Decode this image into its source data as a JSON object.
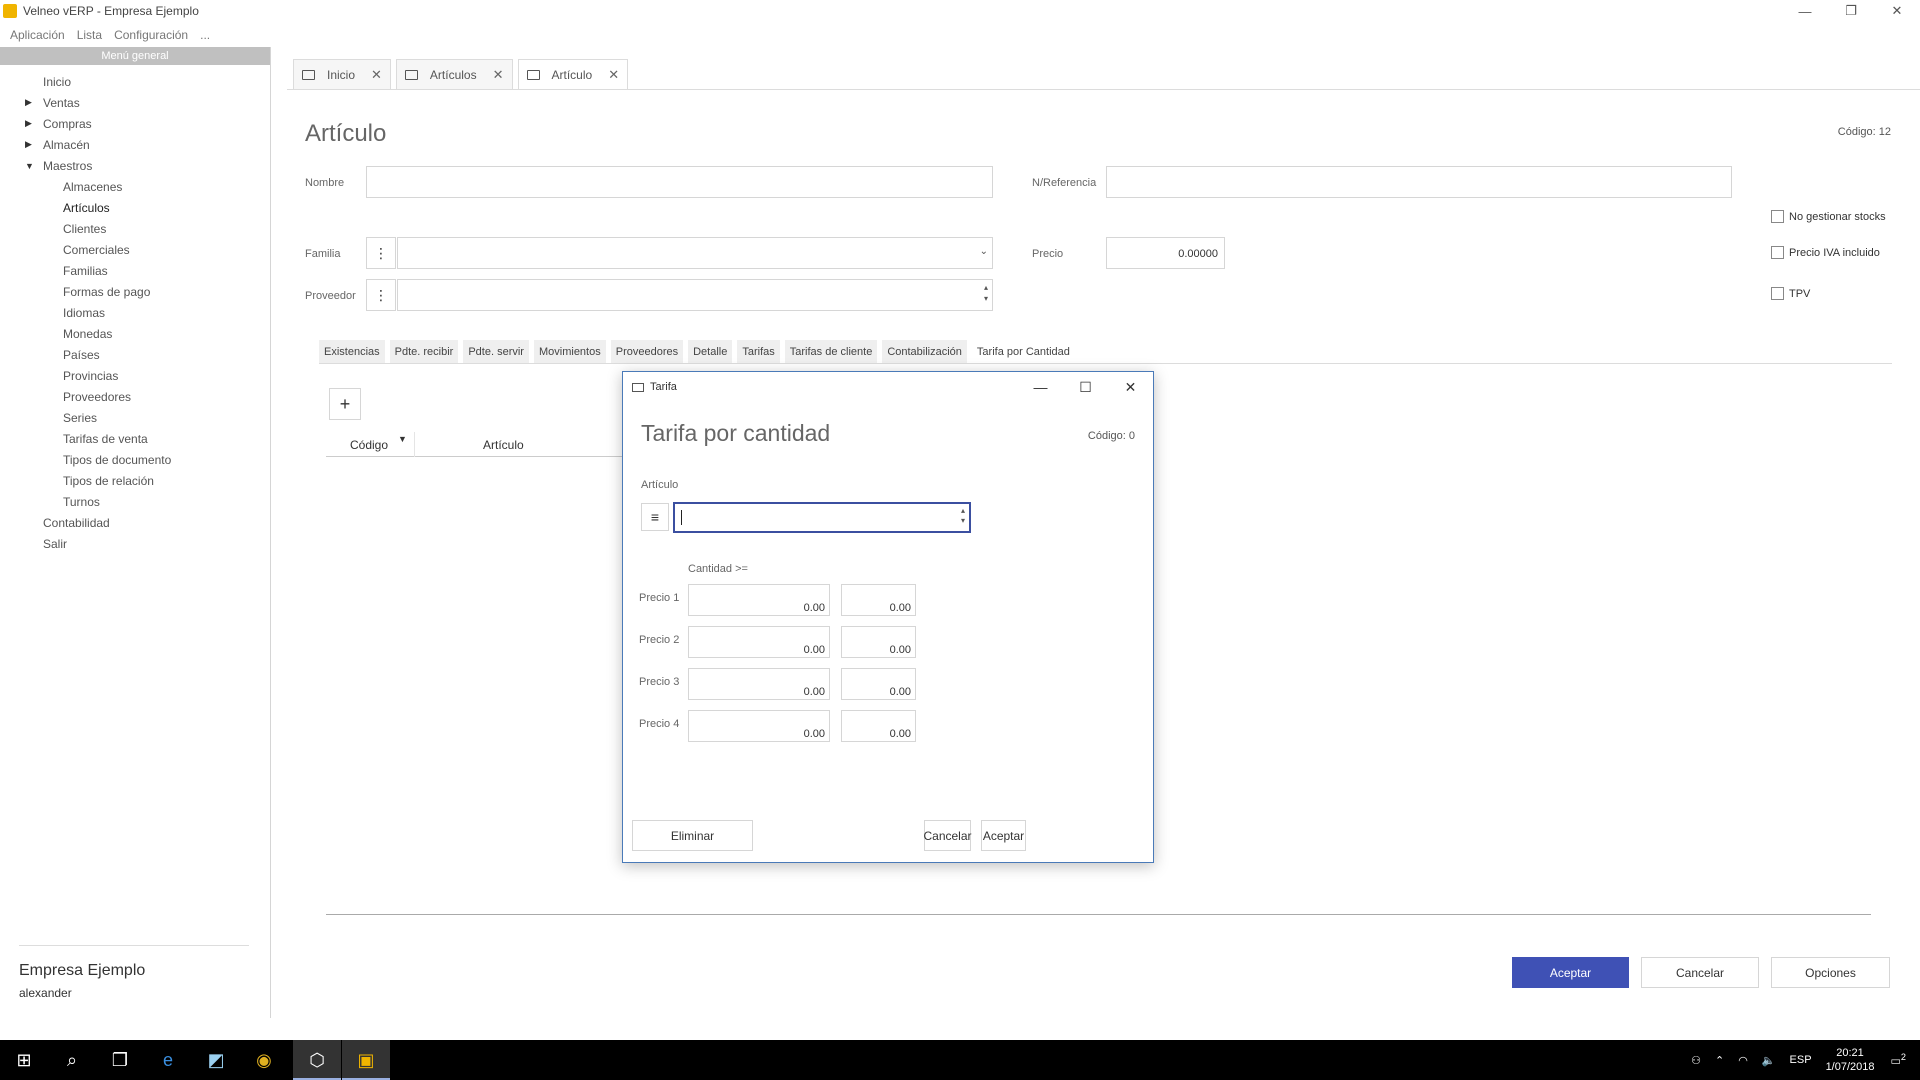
{
  "window": {
    "title": "Velneo vERP - Empresa Ejemplo"
  },
  "menubar": [
    "Aplicación",
    "Lista",
    "Configuración",
    "..."
  ],
  "sidebar": {
    "header": "Menú general",
    "items": [
      {
        "label": "Inicio",
        "level": 0,
        "arrow": ""
      },
      {
        "label": "Ventas",
        "level": 0,
        "arrow": "▶"
      },
      {
        "label": "Compras",
        "level": 0,
        "arrow": "▶"
      },
      {
        "label": "Almacén",
        "level": 0,
        "arrow": "▶"
      },
      {
        "label": "Maestros",
        "level": 0,
        "arrow": "▼"
      },
      {
        "label": "Almacenes",
        "level": 1,
        "arrow": ""
      },
      {
        "label": "Artículos",
        "level": 1,
        "arrow": "",
        "active": true
      },
      {
        "label": "Clientes",
        "level": 1,
        "arrow": ""
      },
      {
        "label": "Comerciales",
        "level": 1,
        "arrow": ""
      },
      {
        "label": "Familias",
        "level": 1,
        "arrow": ""
      },
      {
        "label": "Formas de pago",
        "level": 1,
        "arrow": ""
      },
      {
        "label": "Idiomas",
        "level": 1,
        "arrow": ""
      },
      {
        "label": "Monedas",
        "level": 1,
        "arrow": ""
      },
      {
        "label": "Países",
        "level": 1,
        "arrow": ""
      },
      {
        "label": "Provincias",
        "level": 1,
        "arrow": ""
      },
      {
        "label": "Proveedores",
        "level": 1,
        "arrow": ""
      },
      {
        "label": "Series",
        "level": 1,
        "arrow": ""
      },
      {
        "label": "Tarifas de venta",
        "level": 1,
        "arrow": ""
      },
      {
        "label": "Tipos de documento",
        "level": 1,
        "arrow": ""
      },
      {
        "label": "Tipos de relación",
        "level": 1,
        "arrow": ""
      },
      {
        "label": "Turnos",
        "level": 1,
        "arrow": ""
      },
      {
        "label": "Contabilidad",
        "level": 0,
        "arrow": ""
      },
      {
        "label": "Salir",
        "level": 0,
        "arrow": ""
      }
    ],
    "company": "Empresa Ejemplo",
    "user": "alexander"
  },
  "tabs": [
    {
      "label": "Inicio"
    },
    {
      "label": "Artículos"
    },
    {
      "label": "Artículo",
      "active": true
    }
  ],
  "form": {
    "title": "Artículo",
    "codigo": "Código: 12",
    "nombre_label": "Nombre",
    "nombre_value": "",
    "referencia_label": "N/Referencia",
    "referencia_value": "",
    "familia_label": "Familia",
    "familia_value": "",
    "proveedor_label": "Proveedor",
    "proveedor_value": "",
    "precio_label": "Precio",
    "precio_value": "0.00000",
    "checkboxes": [
      {
        "label": "No gestionar stocks",
        "checked": false
      },
      {
        "label": "Precio IVA incluido",
        "checked": false
      },
      {
        "label": "TPV",
        "checked": false
      }
    ],
    "subtabs": [
      "Existencias",
      "Pdte. recibir",
      "Pdte. servir",
      "Movimientos",
      "Proveedores",
      "Detalle",
      "Tarifas",
      "Tarifas de cliente",
      "Contabilización",
      "Tarifa por Cantidad"
    ],
    "active_subtab": "Tarifa por Cantidad",
    "grid_columns": [
      "Código",
      "Artículo"
    ],
    "buttons": {
      "accept": "Aceptar",
      "cancel": "Cancelar",
      "options": "Opciones"
    }
  },
  "dialog": {
    "window_title": "Tarifa",
    "title": "Tarifa por cantidad",
    "codigo": "Código: 0",
    "articulo_label": "Artículo",
    "articulo_value": "",
    "cantidad_label": "Cantidad >=",
    "rows": [
      {
        "label": "Precio 1",
        "cantidad": "0.00",
        "precio": "0.00"
      },
      {
        "label": "Precio 2",
        "cantidad": "0.00",
        "precio": "0.00"
      },
      {
        "label": "Precio 3",
        "cantidad": "0.00",
        "precio": "0.00"
      },
      {
        "label": "Precio 4",
        "cantidad": "0.00",
        "precio": "0.00"
      }
    ],
    "buttons": {
      "delete": "Eliminar",
      "cancel": "Cancelar",
      "accept": "Aceptar"
    }
  },
  "taskbar": {
    "icons": [
      "windows-icon",
      "search-icon",
      "task-view-icon",
      "edge-icon",
      "store-icon",
      "chrome-icon",
      "velneo-vadmin-icon",
      "velneo-verp-icon"
    ],
    "lang": "ESP",
    "time": "20:21",
    "date": "1/07/2018",
    "notifications": "2"
  },
  "colors": {
    "primary_button": "#3f51b5",
    "focus_border": "#3b4fa0",
    "dialog_border": "#4a7ab8"
  }
}
